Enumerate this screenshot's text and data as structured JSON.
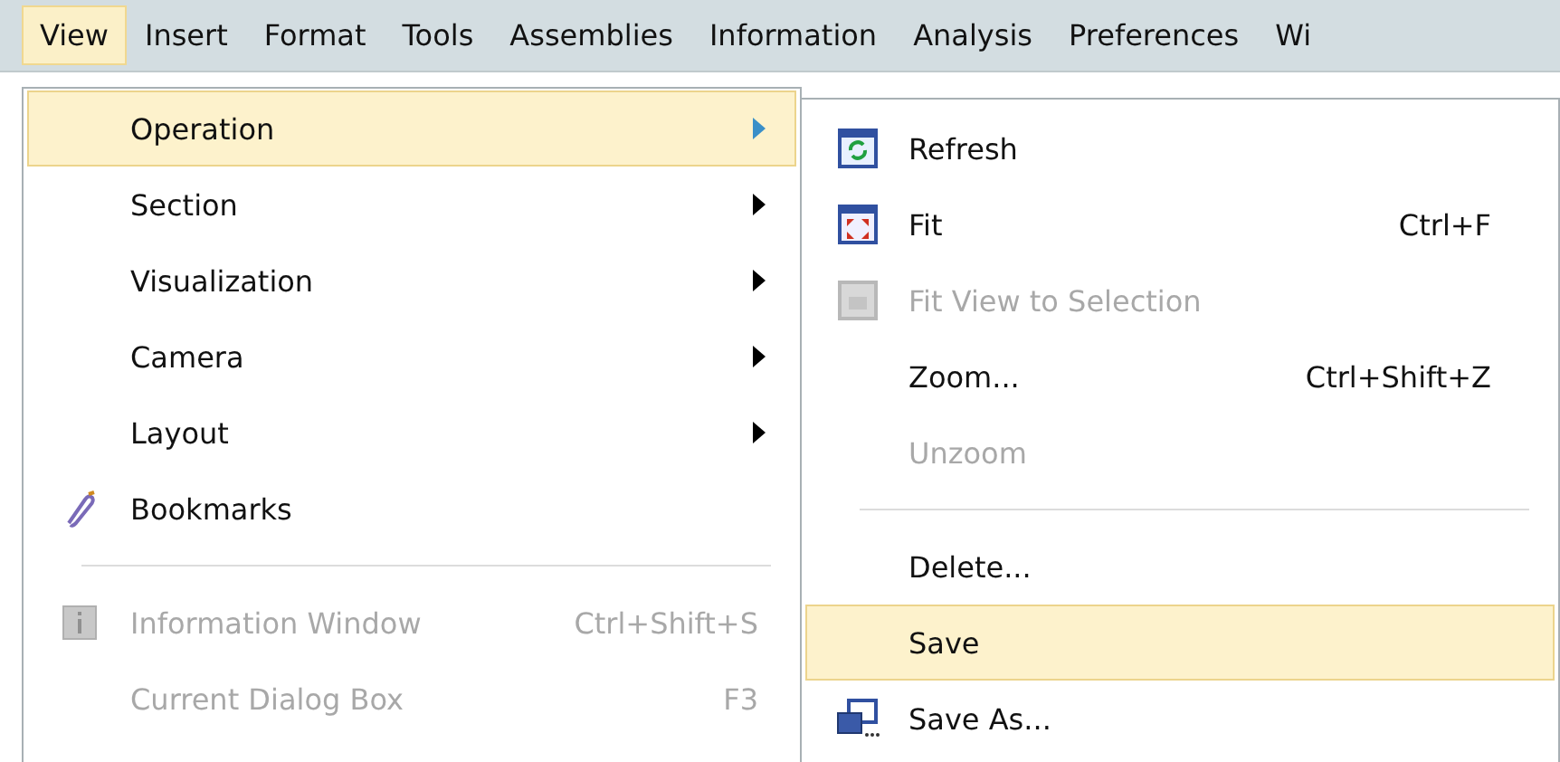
{
  "menubar": [
    {
      "label": "View",
      "selected": true
    },
    {
      "label": "Insert",
      "selected": false
    },
    {
      "label": "Format",
      "selected": false
    },
    {
      "label": "Tools",
      "selected": false
    },
    {
      "label": "Assemblies",
      "selected": false
    },
    {
      "label": "Information",
      "selected": false
    },
    {
      "label": "Analysis",
      "selected": false
    },
    {
      "label": "Preferences",
      "selected": false
    },
    {
      "label": "Wi",
      "selected": false
    }
  ],
  "view_menu": [
    {
      "kind": "item",
      "label": "Operation",
      "submenu": true,
      "selected": true,
      "disabled": false
    },
    {
      "kind": "item",
      "label": "Section",
      "submenu": true,
      "selected": false,
      "disabled": false
    },
    {
      "kind": "item",
      "label": "Visualization",
      "submenu": true,
      "selected": false,
      "disabled": false
    },
    {
      "kind": "item",
      "label": "Camera",
      "submenu": true,
      "selected": false,
      "disabled": false
    },
    {
      "kind": "item",
      "label": "Layout",
      "submenu": true,
      "selected": false,
      "disabled": false
    },
    {
      "kind": "item",
      "label": "Bookmarks",
      "submenu": false,
      "selected": false,
      "disabled": false
    },
    {
      "kind": "separator"
    },
    {
      "kind": "item",
      "label": "Information Window",
      "shortcut": "Ctrl+Shift+S",
      "submenu": false,
      "selected": false,
      "disabled": true
    },
    {
      "kind": "item",
      "label": "Current Dialog Box",
      "shortcut": "F3",
      "submenu": false,
      "selected": false,
      "disabled": true
    }
  ],
  "operation_submenu": [
    {
      "kind": "item",
      "label": "Refresh",
      "selected": false,
      "disabled": false
    },
    {
      "kind": "item",
      "label": "Fit",
      "shortcut": "Ctrl+F",
      "selected": false,
      "disabled": false
    },
    {
      "kind": "item",
      "label": "Fit View to Selection",
      "selected": false,
      "disabled": true
    },
    {
      "kind": "item",
      "label": "Zoom...",
      "shortcut": "Ctrl+Shift+Z",
      "selected": false,
      "disabled": false
    },
    {
      "kind": "item",
      "label": "Unzoom",
      "selected": false,
      "disabled": true
    },
    {
      "kind": "separator"
    },
    {
      "kind": "item",
      "label": "Delete...",
      "selected": false,
      "disabled": false
    },
    {
      "kind": "item",
      "label": "Save",
      "selected": true,
      "disabled": false
    },
    {
      "kind": "item",
      "label": "Save As...",
      "selected": false,
      "disabled": false
    }
  ]
}
